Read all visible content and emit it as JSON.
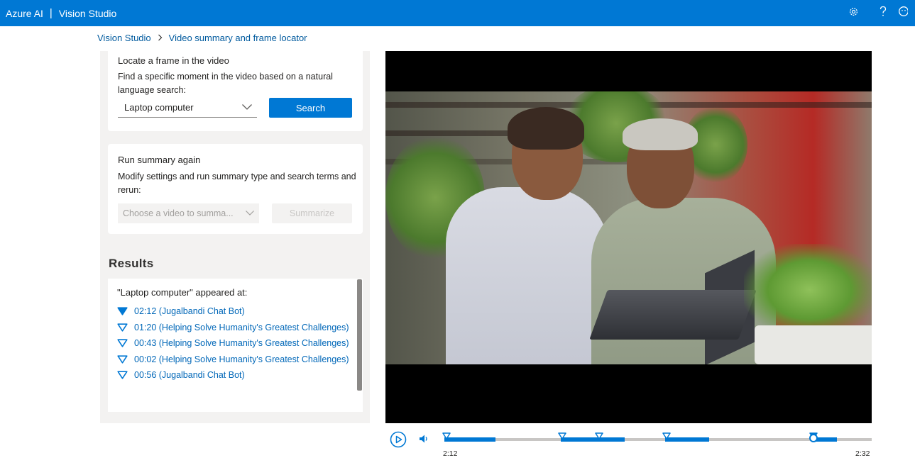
{
  "topbar": {
    "product": "Azure AI",
    "separator": "|",
    "app_name": "Vision Studio",
    "icons": [
      "settings-icon",
      "help-icon",
      "feedback-icon"
    ]
  },
  "breadcrumb": {
    "items": [
      "Vision Studio",
      "Video summary and frame locator"
    ]
  },
  "locate_card": {
    "title": "Locate a frame in the video",
    "description": "Find a specific moment in the video based on a natural language search:",
    "query_value": "Laptop computer",
    "search_label": "Search"
  },
  "summary_card": {
    "title": "Run summary again",
    "description": "Modify settings and run summary type and search terms and rerun:",
    "video_placeholder": "Choose a video to summa...",
    "summarize_label": "Summarize"
  },
  "results": {
    "title": "Results",
    "heading": "\"Laptop computer\" appeared at:",
    "items": [
      {
        "label": "02:12 (Jugalbandi Chat Bot)",
        "active": true
      },
      {
        "label": "01:20 (Helping Solve Humanity's Greatest Challenges)",
        "active": false
      },
      {
        "label": "00:43 (Helping Solve Humanity's Greatest Challenges)",
        "active": false
      },
      {
        "label": "00:02 (Helping Solve Humanity's Greatest Challenges)",
        "active": false
      },
      {
        "label": "00:56 (Jugalbandi Chat Bot)",
        "active": false
      }
    ]
  },
  "player": {
    "current_time": "2:12",
    "duration": "2:32",
    "playhead_fraction": 0.86
  },
  "colors": {
    "accent": "#0078d4",
    "link": "#0067b8",
    "panel_bg": "#f3f2f1"
  }
}
